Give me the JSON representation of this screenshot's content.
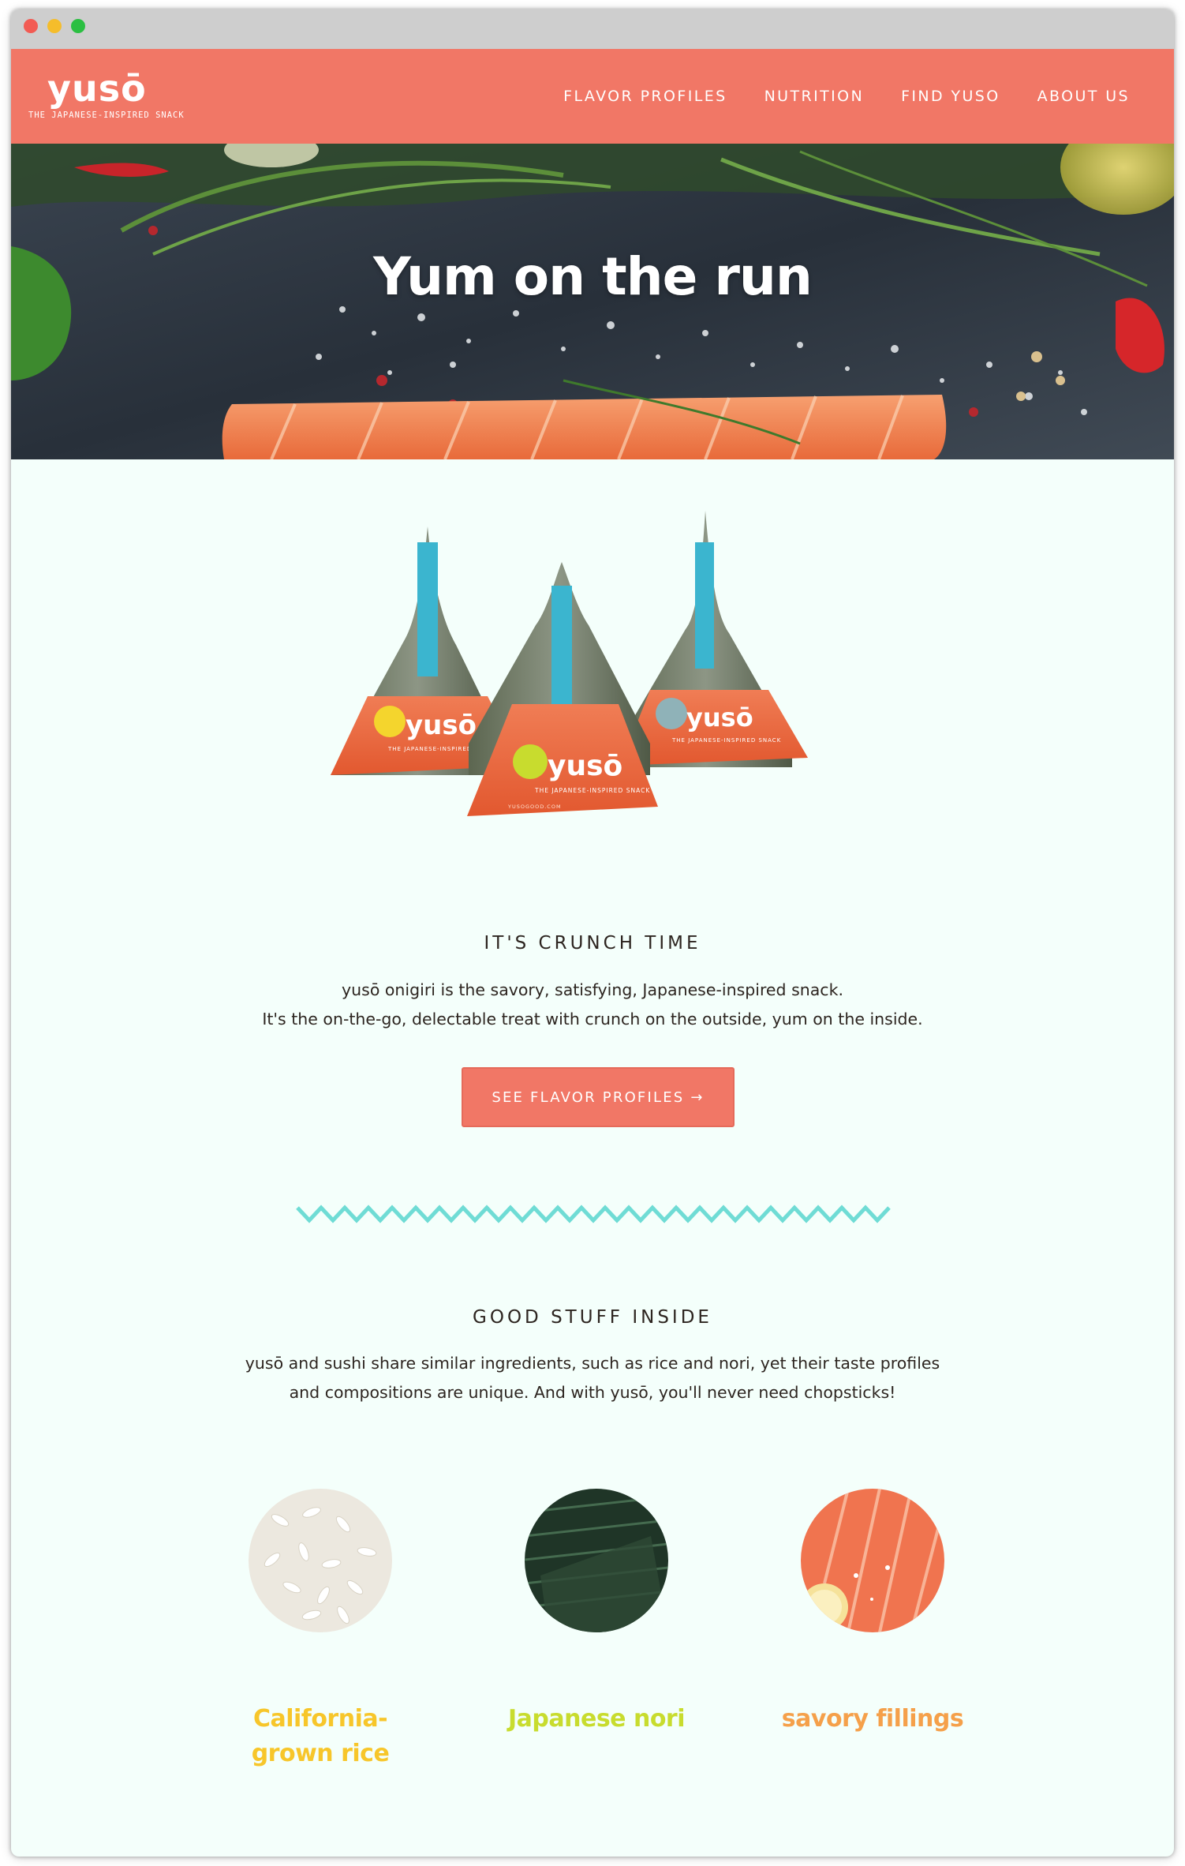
{
  "brand": {
    "name": "yusō",
    "tagline": "THE JAPANESE-INSPIRED SNACK"
  },
  "nav": {
    "items": [
      {
        "label": "FLAVOR PROFILES"
      },
      {
        "label": "NUTRITION"
      },
      {
        "label": "FIND YUSO"
      },
      {
        "label": "ABOUT US"
      }
    ]
  },
  "hero": {
    "title": "Yum on the run"
  },
  "product": {
    "package_brand": "yusō",
    "package_tagline": "THE JAPANESE-INSPIRED SNACK",
    "package_url": "YUSOGOOD.COM"
  },
  "crunch": {
    "heading": "IT'S CRUNCH TIME",
    "line1": "yusō onigiri is the savory, satisfying, Japanese-inspired snack.",
    "line2": "It's the on-the-go, delectable treat with crunch on the outside, yum on the inside.",
    "cta_label": "SEE FLAVOR PROFILES →"
  },
  "inside": {
    "heading": "GOOD STUFF INSIDE",
    "line1": "yusō and sushi share similar ingredients, such as rice and nori, yet their taste profiles",
    "line2": "and compositions are unique. And with yusō, you'll never need chopsticks!"
  },
  "ingredients": [
    {
      "line1": "California-",
      "line2": "grown rice",
      "color": "#f7c62a"
    },
    {
      "line1": "Japanese nori",
      "line2": "",
      "color": "#c8dc2e"
    },
    {
      "line1": "savory fillings",
      "line2": "",
      "color": "#f5a04a"
    }
  ],
  "colors": {
    "brand_coral": "#f17766",
    "zigzag_teal": "#6fdcd5",
    "background_mint": "#f4fffb"
  }
}
